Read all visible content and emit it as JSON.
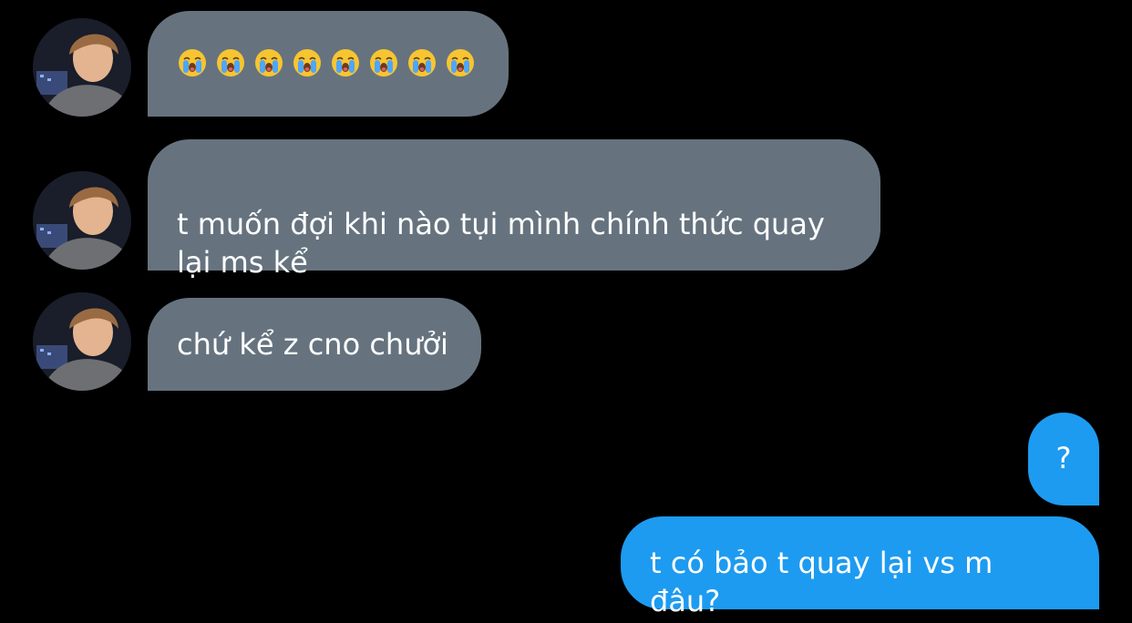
{
  "conversation": {
    "incoming": [
      {
        "emoji_count": 8,
        "emoji": "loudly-crying-face"
      },
      {
        "text": "t muốn đợi khi nào tụi mình chính thức quay\nlại ms kể"
      },
      {
        "text": "chứ kể z cno chưởi"
      }
    ],
    "outgoing": [
      {
        "text": "?"
      },
      {
        "text": "t có bảo t quay lại vs m đâu?"
      }
    ]
  },
  "colors": {
    "background": "#000000",
    "incoming_bubble": "#66737f",
    "outgoing_bubble": "#1d9bf0",
    "text": "#ffffff"
  }
}
